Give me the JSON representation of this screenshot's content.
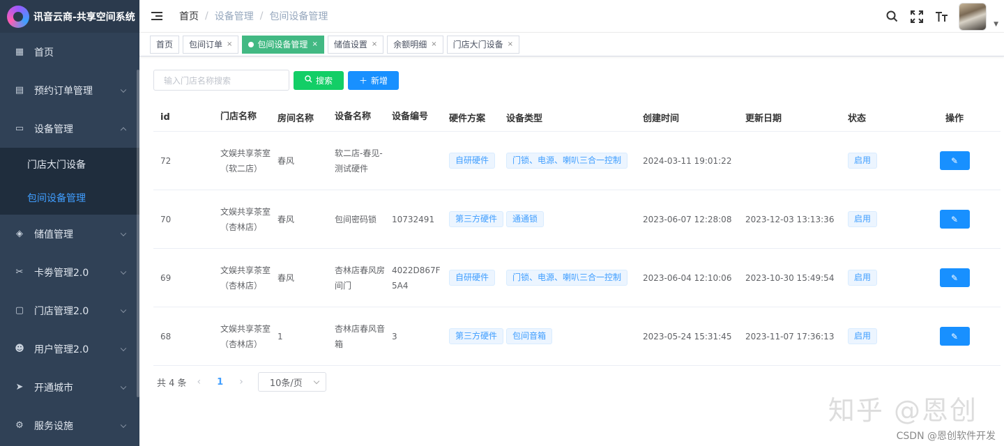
{
  "app": {
    "title": "讯音云商-共享空间系统"
  },
  "sidebar": {
    "items": [
      {
        "label": "首页",
        "icon": "dashboard-icon"
      },
      {
        "label": "预约订单管理",
        "icon": "order-icon"
      },
      {
        "label": "设备管理",
        "icon": "device-icon"
      },
      {
        "label": "储值管理",
        "icon": "stored-value-icon"
      },
      {
        "label": "卡劵管理2.0",
        "icon": "coupon-icon"
      },
      {
        "label": "门店管理2.0",
        "icon": "store-icon"
      },
      {
        "label": "用户管理2.0",
        "icon": "users-icon"
      },
      {
        "label": "开通城市",
        "icon": "send-icon"
      },
      {
        "label": "服务设施",
        "icon": "gear-icon"
      }
    ],
    "device_submenu": [
      {
        "label": "门店大门设备"
      },
      {
        "label": "包间设备管理"
      }
    ]
  },
  "header": {
    "breadcrumb": [
      "首页",
      "设备管理",
      "包间设备管理"
    ]
  },
  "tags": [
    {
      "label": "首页"
    },
    {
      "label": "包间订单"
    },
    {
      "label": "包间设备管理"
    },
    {
      "label": "储值设置"
    },
    {
      "label": "余额明细"
    },
    {
      "label": "门店大门设备"
    }
  ],
  "toolbar": {
    "search_placeholder": "输入门店名称搜索",
    "search_label": "搜索",
    "add_label": "新增"
  },
  "table": {
    "columns": [
      "id",
      "门店名称",
      "房间名称",
      "设备名称",
      "设备编号",
      "硬件方案",
      "设备类型",
      "创建时间",
      "更新日期",
      "状态",
      "操作"
    ],
    "rows": [
      {
        "id": "72",
        "store": "文娱共享茶室（软二店）",
        "room": "春风",
        "device": "软二店-春见-测试硬件",
        "code": "",
        "hardware": "自研硬件",
        "type": "门锁、电源、喇叭三合一控制",
        "created": "2024-03-11 19:01:22",
        "updated": "",
        "status": "启用"
      },
      {
        "id": "70",
        "store": "文娱共享茶室（杏林店）",
        "room": "春风",
        "device": "包间密码锁",
        "code": "10732491",
        "hardware": "第三方硬件",
        "type": "通通锁",
        "created": "2023-06-07 12:28:08",
        "updated": "2023-12-03 13:13:36",
        "status": "启用"
      },
      {
        "id": "69",
        "store": "文娱共享茶室（杏林店）",
        "room": "春风",
        "device": "杏林店春风房间门",
        "code": "4022D867F5A4",
        "hardware": "自研硬件",
        "type": "门锁、电源、喇叭三合一控制",
        "created": "2023-06-04 12:10:06",
        "updated": "2023-10-30 15:49:54",
        "status": "启用"
      },
      {
        "id": "68",
        "store": "文娱共享茶室（杏林店）",
        "room": "1",
        "device": "杏林店春风音箱",
        "code": "3",
        "hardware": "第三方硬件",
        "type": "包间音箱",
        "created": "2023-05-24 15:31:45",
        "updated": "2023-11-07 17:36:13",
        "status": "启用"
      }
    ]
  },
  "pagination": {
    "total_text": "共 4 条",
    "current_page": "1",
    "page_size": "10条/页"
  },
  "watermark": {
    "main": "知乎 @恩创",
    "footer": "CSDN @恩创软件开发"
  }
}
